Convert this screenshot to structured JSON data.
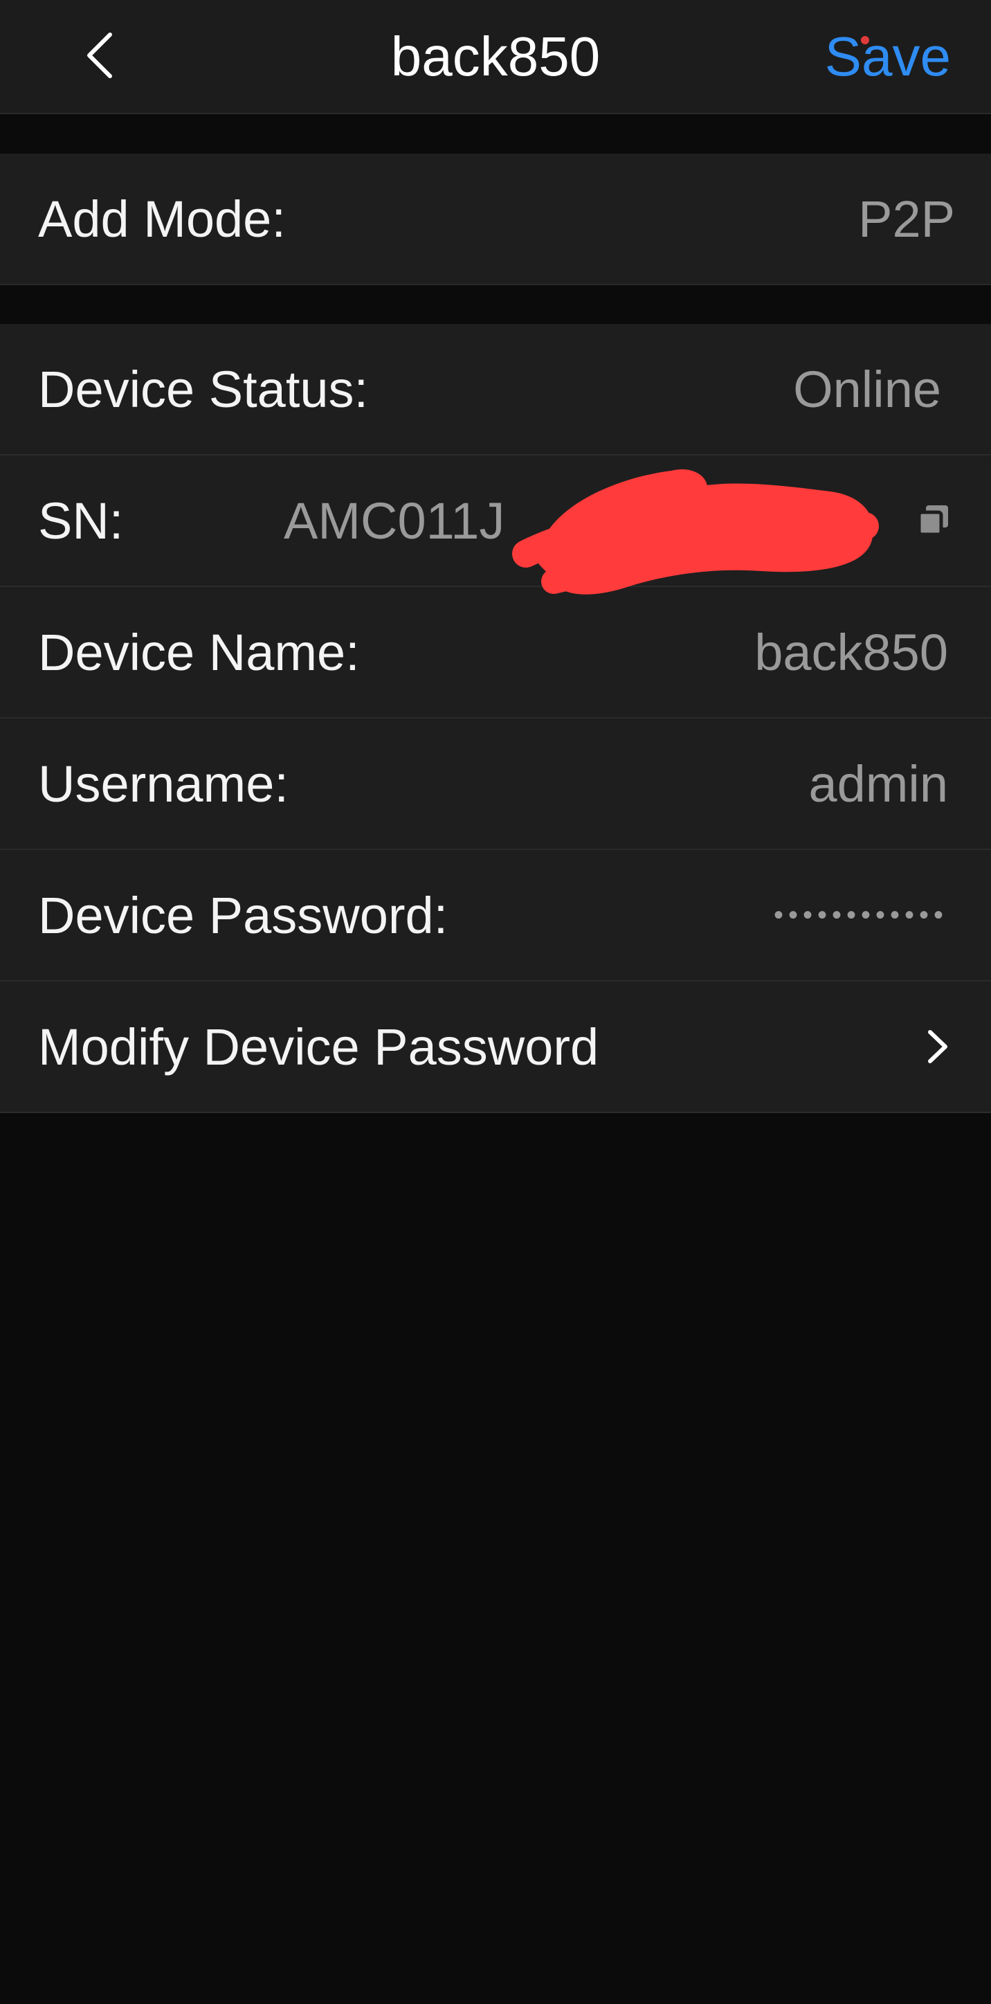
{
  "header": {
    "title": "back850",
    "save_label": "Save"
  },
  "rows": {
    "add_mode": {
      "label": "Add Mode:",
      "value": "P2P"
    },
    "device_status": {
      "label": "Device Status:",
      "value": "Online"
    },
    "sn": {
      "label": "SN:",
      "value": "AMC011J"
    },
    "device_name": {
      "label": "Device Name:",
      "value": "back850"
    },
    "username": {
      "label": "Username:",
      "value": "admin"
    },
    "device_password": {
      "label": "Device Password:",
      "value": "••••••••••••"
    },
    "modify_password": {
      "label": "Modify Device Password"
    }
  },
  "colors": {
    "accent": "#2f8cf2",
    "redaction": "#ff3b3b",
    "background": "#0b0b0b",
    "row_background": "#1e1e1e"
  },
  "icons": {
    "back": "chevron-left-icon",
    "copy": "copy-icon",
    "chevron": "chevron-right-icon"
  }
}
